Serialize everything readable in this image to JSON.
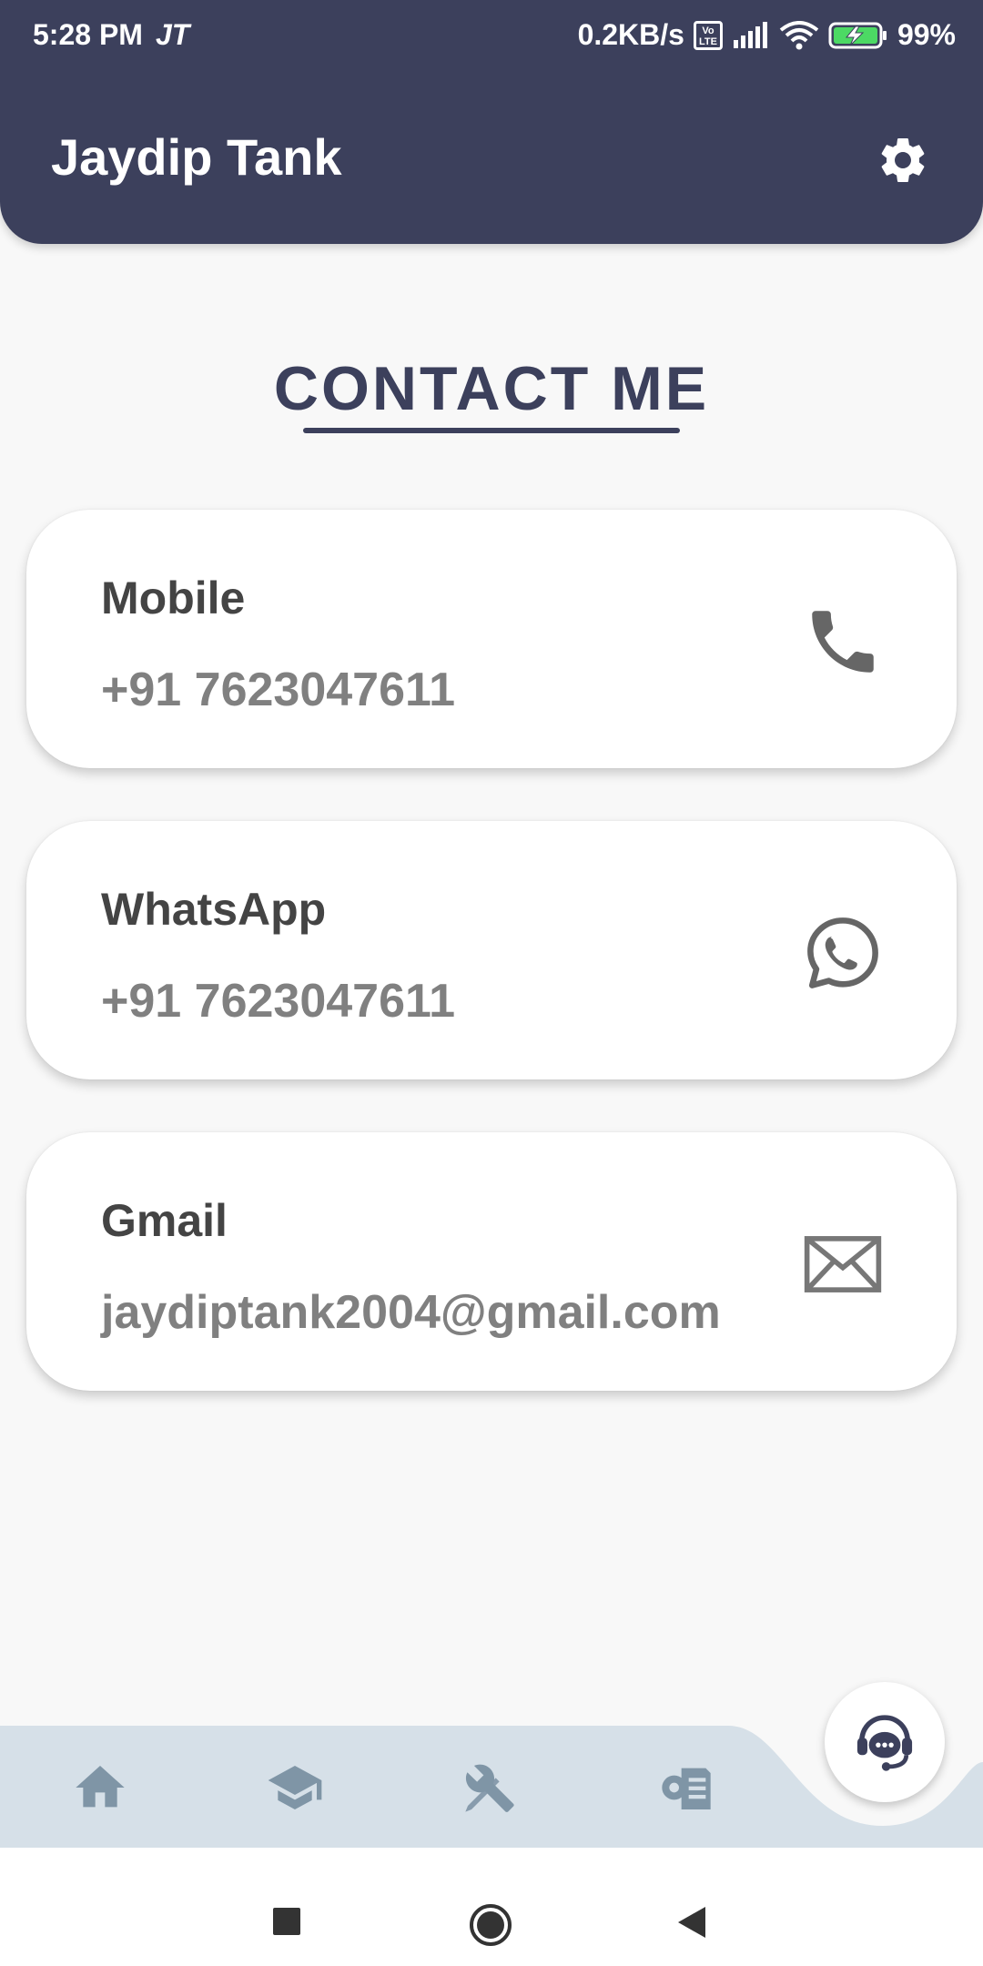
{
  "status_bar": {
    "time": "5:28 PM",
    "carrier": "JT",
    "speed": "0.2KB/s",
    "volte": "Vo LTE",
    "battery": "99%"
  },
  "appbar": {
    "title": "Jaydip Tank",
    "settings_icon": "gear-icon"
  },
  "section": {
    "title": "CONTACT ME"
  },
  "contacts": [
    {
      "label": "Mobile",
      "value": "+91 7623047611",
      "icon": "phone-icon"
    },
    {
      "label": "WhatsApp",
      "value": "+91 7623047611",
      "icon": "whatsapp-icon"
    },
    {
      "label": "Gmail",
      "value": "jaydiptank2004@gmail.com",
      "icon": "mail-icon"
    }
  ],
  "bottom_nav": {
    "items": [
      {
        "icon": "home-icon"
      },
      {
        "icon": "graduation-cap-icon"
      },
      {
        "icon": "tools-icon"
      },
      {
        "icon": "projects-icon"
      }
    ],
    "fab_icon": "chat-support-icon"
  },
  "system_nav": {
    "items": [
      "recents",
      "home",
      "back"
    ]
  },
  "colors": {
    "primary": "#3c405c",
    "background": "#f8f8f8",
    "nav_bar": "#d6e0e8",
    "nav_icon": "#7f95a6"
  }
}
